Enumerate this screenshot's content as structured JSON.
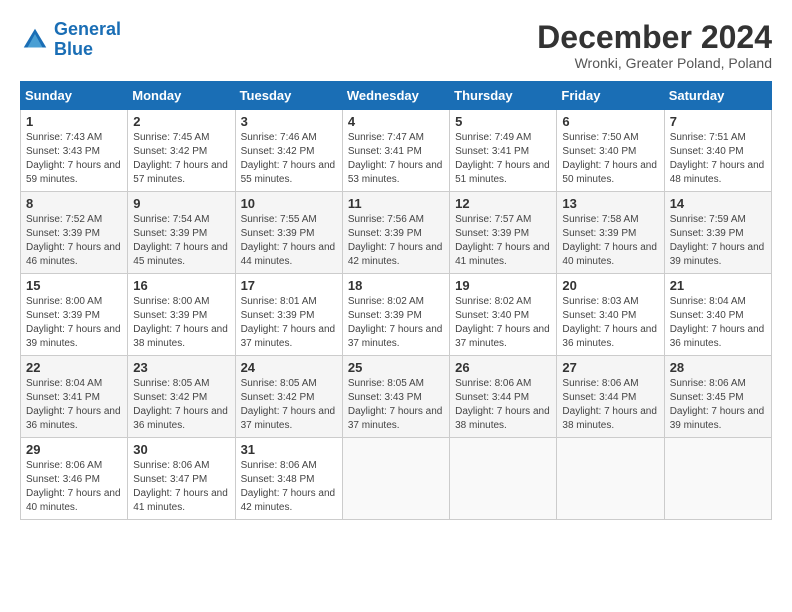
{
  "header": {
    "logo_line1": "General",
    "logo_line2": "Blue",
    "title": "December 2024",
    "subtitle": "Wronki, Greater Poland, Poland"
  },
  "weekdays": [
    "Sunday",
    "Monday",
    "Tuesday",
    "Wednesday",
    "Thursday",
    "Friday",
    "Saturday"
  ],
  "weeks": [
    [
      {
        "day": "1",
        "sunrise": "7:43 AM",
        "sunset": "3:43 PM",
        "daylight": "7 hours and 59 minutes."
      },
      {
        "day": "2",
        "sunrise": "7:45 AM",
        "sunset": "3:42 PM",
        "daylight": "7 hours and 57 minutes."
      },
      {
        "day": "3",
        "sunrise": "7:46 AM",
        "sunset": "3:42 PM",
        "daylight": "7 hours and 55 minutes."
      },
      {
        "day": "4",
        "sunrise": "7:47 AM",
        "sunset": "3:41 PM",
        "daylight": "7 hours and 53 minutes."
      },
      {
        "day": "5",
        "sunrise": "7:49 AM",
        "sunset": "3:41 PM",
        "daylight": "7 hours and 51 minutes."
      },
      {
        "day": "6",
        "sunrise": "7:50 AM",
        "sunset": "3:40 PM",
        "daylight": "7 hours and 50 minutes."
      },
      {
        "day": "7",
        "sunrise": "7:51 AM",
        "sunset": "3:40 PM",
        "daylight": "7 hours and 48 minutes."
      }
    ],
    [
      {
        "day": "8",
        "sunrise": "7:52 AM",
        "sunset": "3:39 PM",
        "daylight": "7 hours and 46 minutes."
      },
      {
        "day": "9",
        "sunrise": "7:54 AM",
        "sunset": "3:39 PM",
        "daylight": "7 hours and 45 minutes."
      },
      {
        "day": "10",
        "sunrise": "7:55 AM",
        "sunset": "3:39 PM",
        "daylight": "7 hours and 44 minutes."
      },
      {
        "day": "11",
        "sunrise": "7:56 AM",
        "sunset": "3:39 PM",
        "daylight": "7 hours and 42 minutes."
      },
      {
        "day": "12",
        "sunrise": "7:57 AM",
        "sunset": "3:39 PM",
        "daylight": "7 hours and 41 minutes."
      },
      {
        "day": "13",
        "sunrise": "7:58 AM",
        "sunset": "3:39 PM",
        "daylight": "7 hours and 40 minutes."
      },
      {
        "day": "14",
        "sunrise": "7:59 AM",
        "sunset": "3:39 PM",
        "daylight": "7 hours and 39 minutes."
      }
    ],
    [
      {
        "day": "15",
        "sunrise": "8:00 AM",
        "sunset": "3:39 PM",
        "daylight": "7 hours and 39 minutes."
      },
      {
        "day": "16",
        "sunrise": "8:00 AM",
        "sunset": "3:39 PM",
        "daylight": "7 hours and 38 minutes."
      },
      {
        "day": "17",
        "sunrise": "8:01 AM",
        "sunset": "3:39 PM",
        "daylight": "7 hours and 37 minutes."
      },
      {
        "day": "18",
        "sunrise": "8:02 AM",
        "sunset": "3:39 PM",
        "daylight": "7 hours and 37 minutes."
      },
      {
        "day": "19",
        "sunrise": "8:02 AM",
        "sunset": "3:40 PM",
        "daylight": "7 hours and 37 minutes."
      },
      {
        "day": "20",
        "sunrise": "8:03 AM",
        "sunset": "3:40 PM",
        "daylight": "7 hours and 36 minutes."
      },
      {
        "day": "21",
        "sunrise": "8:04 AM",
        "sunset": "3:40 PM",
        "daylight": "7 hours and 36 minutes."
      }
    ],
    [
      {
        "day": "22",
        "sunrise": "8:04 AM",
        "sunset": "3:41 PM",
        "daylight": "7 hours and 36 minutes."
      },
      {
        "day": "23",
        "sunrise": "8:05 AM",
        "sunset": "3:42 PM",
        "daylight": "7 hours and 36 minutes."
      },
      {
        "day": "24",
        "sunrise": "8:05 AM",
        "sunset": "3:42 PM",
        "daylight": "7 hours and 37 minutes."
      },
      {
        "day": "25",
        "sunrise": "8:05 AM",
        "sunset": "3:43 PM",
        "daylight": "7 hours and 37 minutes."
      },
      {
        "day": "26",
        "sunrise": "8:06 AM",
        "sunset": "3:44 PM",
        "daylight": "7 hours and 38 minutes."
      },
      {
        "day": "27",
        "sunrise": "8:06 AM",
        "sunset": "3:44 PM",
        "daylight": "7 hours and 38 minutes."
      },
      {
        "day": "28",
        "sunrise": "8:06 AM",
        "sunset": "3:45 PM",
        "daylight": "7 hours and 39 minutes."
      }
    ],
    [
      {
        "day": "29",
        "sunrise": "8:06 AM",
        "sunset": "3:46 PM",
        "daylight": "7 hours and 40 minutes."
      },
      {
        "day": "30",
        "sunrise": "8:06 AM",
        "sunset": "3:47 PM",
        "daylight": "7 hours and 41 minutes."
      },
      {
        "day": "31",
        "sunrise": "8:06 AM",
        "sunset": "3:48 PM",
        "daylight": "7 hours and 42 minutes."
      },
      null,
      null,
      null,
      null
    ]
  ]
}
